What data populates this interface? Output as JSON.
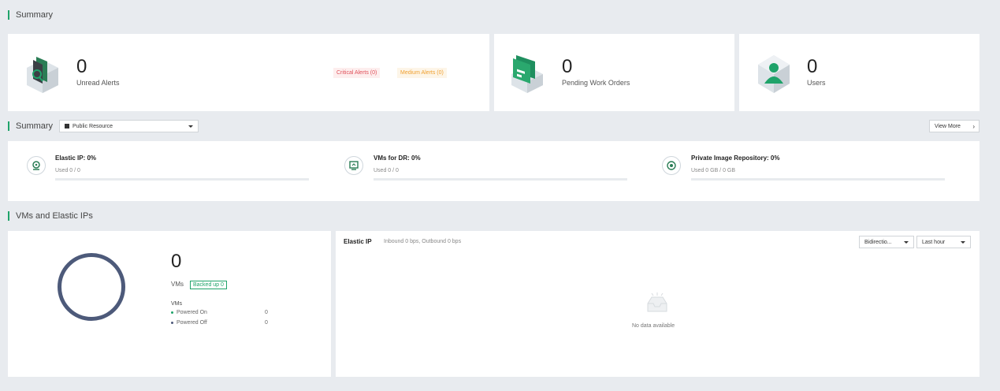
{
  "summary": {
    "title": "Summary",
    "alerts": {
      "count": "0",
      "label": "Unread Alerts",
      "critical": "Critical Alerts (0)",
      "medium": "Medium Alerts (0)"
    },
    "work_orders": {
      "count": "0",
      "label": "Pending Work Orders"
    },
    "users": {
      "count": "0",
      "label": "Users"
    }
  },
  "resources": {
    "title": "Summary",
    "selector": "Public Resource",
    "view_more": "View More",
    "metrics": [
      {
        "title": "Elastic IP: 0%",
        "used": "Used 0 / 0",
        "percent": 0,
        "icon": "elastic-ip-icon"
      },
      {
        "title": "VMs for DR: 0%",
        "used": "Used 0 / 0",
        "percent": 0,
        "icon": "vm-dr-icon"
      },
      {
        "title": "Private Image Repository: 0%",
        "used": "Used 0 GB / 0 GB",
        "percent": 0,
        "icon": "image-repository-icon"
      }
    ]
  },
  "vms_section": {
    "title": "VMs and Elastic IPs",
    "vm_count": "0",
    "vm_label": "VMs",
    "backed_up": "Backed up 0",
    "legend_title": "VMs",
    "legend": [
      {
        "label": "Powered On",
        "value": "0",
        "color": "#1fa36a"
      },
      {
        "label": "Powered Off",
        "value": "0",
        "color": "#4d5a7a"
      }
    ]
  },
  "elastic_ip_panel": {
    "title": "Elastic IP",
    "subtitle": "Inbound 0 bps, Outbound 0 bps",
    "direction": "Bidirectio...",
    "time_range": "Last hour",
    "empty_text": "No data available"
  },
  "colors": {
    "accent": "#1fa36a",
    "ring": "#4d5a7a",
    "critical": "#e0505a",
    "medium": "#f0a030",
    "background": "#e8ebef"
  }
}
